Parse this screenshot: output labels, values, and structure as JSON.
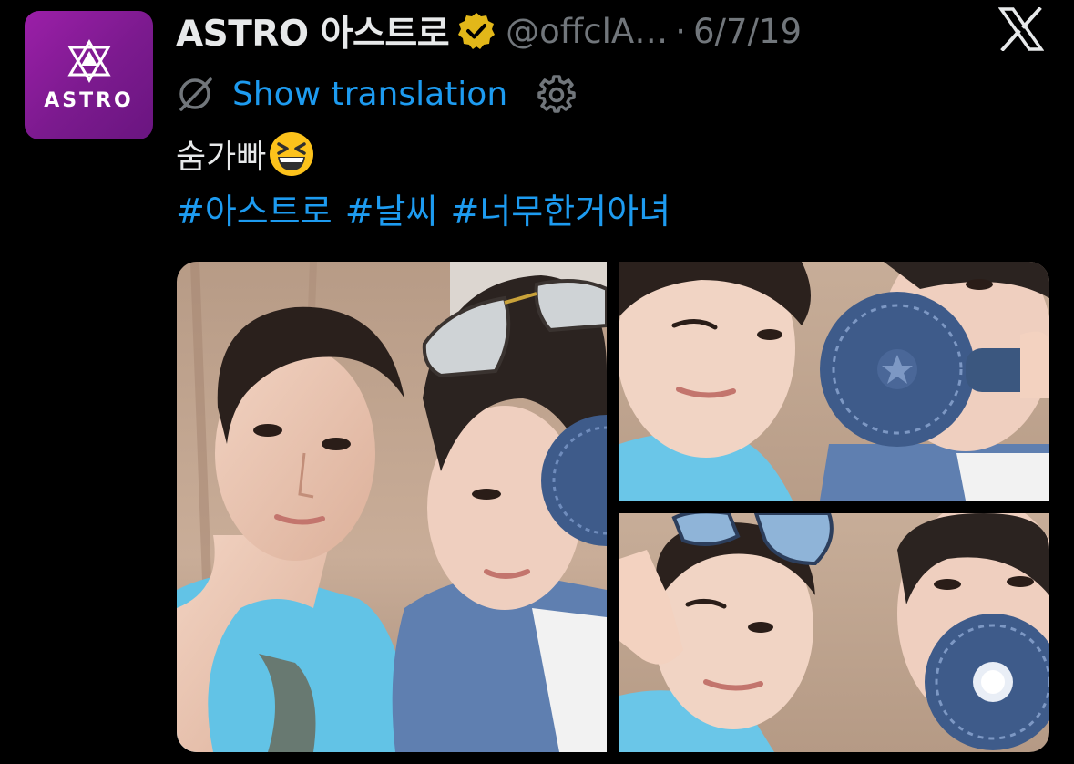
{
  "author": {
    "display_name": "ASTRO 아스트로",
    "handle": "@offclA…",
    "separator": "·",
    "date": "6/7/19",
    "avatar_text": "ASTRO",
    "verified_color": "#e2b719"
  },
  "translation": {
    "label": "Show translation"
  },
  "tweet": {
    "text": "숨가빠",
    "emoji": "grinning-squinting-face",
    "hashtags": [
      "#아스트로",
      "#날씨",
      "#너무한거아녀"
    ]
  },
  "media": {
    "photos": [
      {
        "name": "photo-1",
        "description": "selfie-two-members-with-sunglasses-and-fan"
      },
      {
        "name": "photo-2",
        "description": "member-winking-with-blue-fan"
      },
      {
        "name": "photo-3",
        "description": "member-making-v-sign-with-fan"
      }
    ]
  },
  "colors": {
    "background": "#000000",
    "text": "#e7e9ea",
    "secondary_text": "#71767b",
    "link": "#1d9bf0",
    "avatar_purple": "#8e1c9e"
  },
  "icons": {
    "brand": "x-logo-icon",
    "translate": "globe-off-icon",
    "settings": "gear-icon",
    "verified": "verified-badge-icon"
  }
}
